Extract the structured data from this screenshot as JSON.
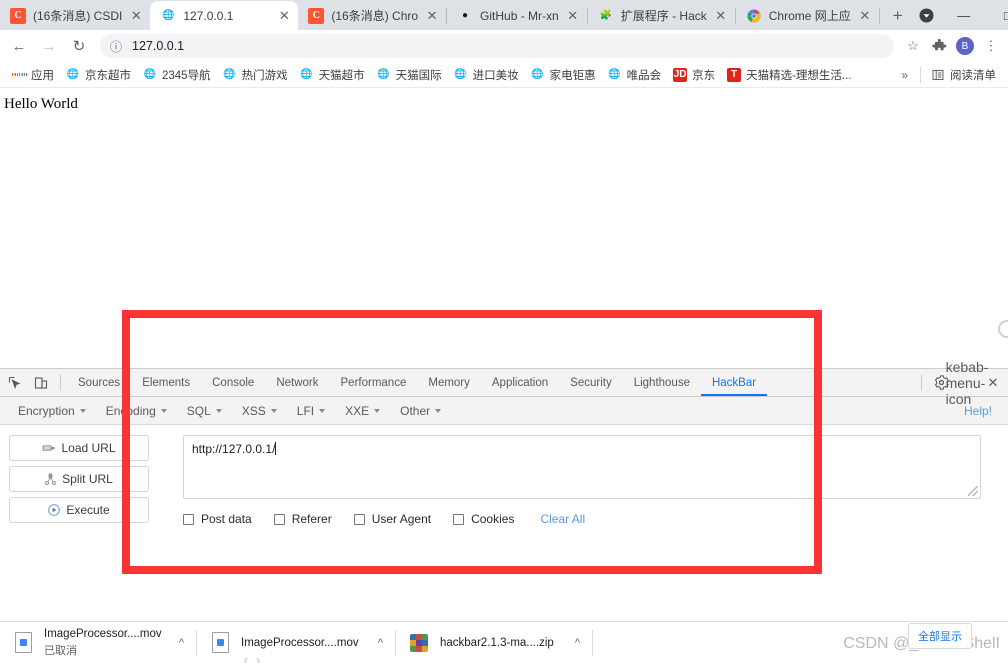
{
  "browser": {
    "tabs": [
      {
        "label": "(16条消息) CSDI",
        "favicon": "csdn-icon",
        "active": false
      },
      {
        "label": "127.0.0.1",
        "favicon": "globe-icon",
        "active": true
      },
      {
        "label": "(16条消息) Chro",
        "favicon": "csdn-icon",
        "active": false
      },
      {
        "label": "GitHub - Mr-xn",
        "favicon": "github-icon",
        "active": false
      },
      {
        "label": "扩展程序 - Hack",
        "favicon": "puzzle-icon",
        "active": false
      },
      {
        "label": "Chrome 网上应",
        "favicon": "chrome-icon",
        "active": false
      }
    ],
    "new_tab_label": "+",
    "window_controls": {
      "minimize": "—",
      "maximize": "□",
      "close": "✕"
    },
    "toolbar": {
      "back": "←",
      "forward": "→",
      "reload": "↻",
      "url": "127.0.0.1",
      "bookmark_star": "☆",
      "extensions": "puzzle-icon",
      "profile_initial": "B",
      "menu": "⋮"
    },
    "bookmarks": [
      {
        "label": "应用",
        "icon": "apps-grid-icon"
      },
      {
        "label": "京东超市",
        "icon": "globe-icon"
      },
      {
        "label": "2345导航",
        "icon": "globe-icon"
      },
      {
        "label": "热门游戏",
        "icon": "globe-icon"
      },
      {
        "label": "天猫超市",
        "icon": "globe-icon"
      },
      {
        "label": "天猫国际",
        "icon": "globe-icon"
      },
      {
        "label": "进口美妆",
        "icon": "globe-icon"
      },
      {
        "label": "家电钜惠",
        "icon": "globe-icon"
      },
      {
        "label": "唯品会",
        "icon": "globe-icon"
      },
      {
        "label": "京东",
        "icon": "jd-icon"
      },
      {
        "label": "天猫精选-理想生活...",
        "icon": "tmall-icon"
      }
    ],
    "bookmarks_overflow": "»",
    "reading_list": {
      "label": "阅读清单",
      "icon": "reading-list-icon"
    }
  },
  "page": {
    "body_text": "Hello World"
  },
  "devtools": {
    "inspect_icon": "inspect-element-icon",
    "device_icon": "device-toolbar-icon",
    "tabs": [
      {
        "label": "Sources",
        "active": false
      },
      {
        "label": "Elements",
        "active": false
      },
      {
        "label": "Console",
        "active": false
      },
      {
        "label": "Network",
        "active": false
      },
      {
        "label": "Performance",
        "active": false
      },
      {
        "label": "Memory",
        "active": false
      },
      {
        "label": "Application",
        "active": false
      },
      {
        "label": "Security",
        "active": false
      },
      {
        "label": "Lighthouse",
        "active": false
      },
      {
        "label": "HackBar",
        "active": true
      }
    ],
    "settings_icon": "gear-icon",
    "more_icon": "kebab-menu-icon",
    "close_icon": "close-icon"
  },
  "hackbar": {
    "menus": [
      {
        "label": "Encryption"
      },
      {
        "label": "Encoding"
      },
      {
        "label": "SQL"
      },
      {
        "label": "XSS"
      },
      {
        "label": "LFI"
      },
      {
        "label": "XXE"
      },
      {
        "label": "Other"
      }
    ],
    "help_label": "Help!",
    "buttons": [
      {
        "label": "Load URL",
        "icon": "load-url-icon"
      },
      {
        "label": "Split URL",
        "icon": "split-url-icon"
      },
      {
        "label": "Execute",
        "icon": "execute-play-icon"
      }
    ],
    "url_value": "http://127.0.0.1/",
    "url_placeholder": "",
    "checkboxes": [
      {
        "label": "Post data",
        "checked": false
      },
      {
        "label": "Referer",
        "checked": false
      },
      {
        "label": "User Agent",
        "checked": false
      },
      {
        "label": "Cookies",
        "checked": false
      }
    ],
    "clear_all_label": "Clear All"
  },
  "downloads": [
    {
      "name": "ImageProcessor....mov",
      "status": "已取消",
      "icon": "file-icon"
    },
    {
      "name": "ImageProcessor....mov",
      "status": "",
      "icon": "file-icon"
    },
    {
      "name": "hackbar2.1.3-ma....zip",
      "status": "",
      "icon": "zip-icon"
    }
  ],
  "shelf": {
    "show_all_label": "全部显示",
    "chevron": "^"
  },
  "watermark": {
    "text": "CSDN @_PowerShelI"
  },
  "annotation": {
    "color": "#fa3434"
  }
}
